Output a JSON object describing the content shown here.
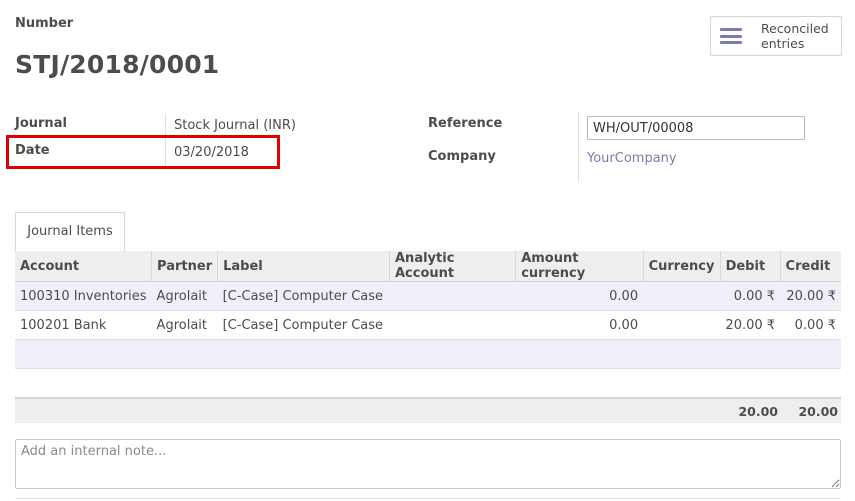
{
  "header": {
    "number_label": "Number",
    "title": "STJ/2018/0001",
    "reconciled_button": "Reconciled entries"
  },
  "fields": {
    "journal_label": "Journal",
    "journal_value": "Stock Journal (INR)",
    "date_label": "Date",
    "date_value": "03/20/2018",
    "reference_label": "Reference",
    "reference_value": "WH/OUT/00008",
    "company_label": "Company",
    "company_value": "YourCompany"
  },
  "tabs": [
    {
      "label": "Journal Items",
      "active": true
    }
  ],
  "table": {
    "columns": [
      "Account",
      "Partner",
      "Label",
      "Analytic Account",
      "Amount currency",
      "Currency",
      "Debit",
      "Credit"
    ],
    "rows": [
      {
        "account": "100310 Inventories",
        "partner": "Agrolait",
        "label": "[C-Case] Computer Case",
        "analytic": "",
        "amount_currency": "0.00",
        "currency": "",
        "debit": "0.00 ₹",
        "credit": "20.00 ₹"
      },
      {
        "account": "100201 Bank",
        "partner": "Agrolait",
        "label": "[C-Case] Computer Case",
        "analytic": "",
        "amount_currency": "0.00",
        "currency": "",
        "debit": "20.00 ₹",
        "credit": "0.00 ₹"
      }
    ],
    "totals": {
      "debit": "20.00",
      "credit": "20.00"
    }
  },
  "note": {
    "placeholder": "Add an internal note..."
  },
  "colors": {
    "accent": "#7c7bad",
    "highlight": "#e00000"
  }
}
